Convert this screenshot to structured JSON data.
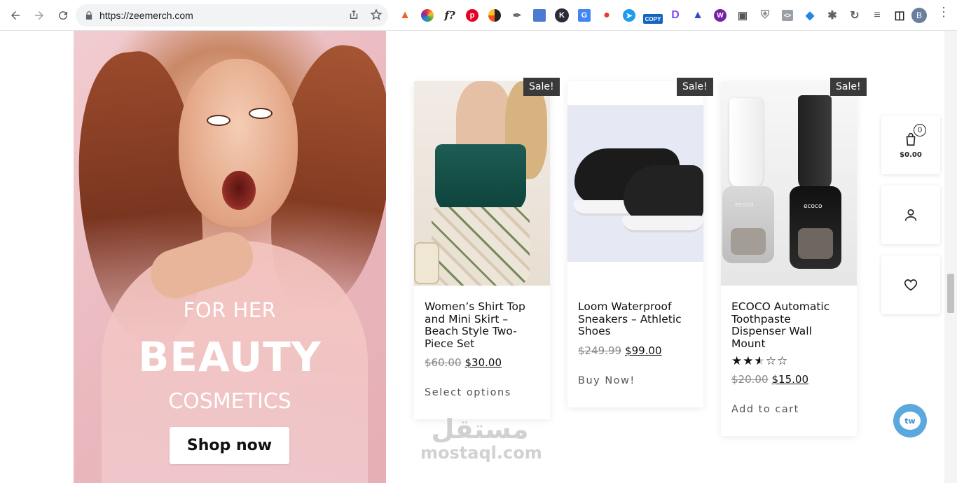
{
  "browser": {
    "url": "https://zeemerch.com",
    "profile_initial": "B",
    "extensions": [
      "fire-icon",
      "color-wheel-icon",
      "font-icon",
      "pinterest-icon",
      "color-drop-icon",
      "dropper-icon",
      "calendar-icon",
      "k-icon",
      "translate-icon",
      "paint-icon",
      "arrow-icon",
      "copy-icon",
      "d-icon",
      "triangle-icon",
      "w-icon",
      "camera-icon",
      "shield-icon",
      "code-icon",
      "diamond-icon",
      "puzzle-icon",
      "refresh-icon",
      "queue-icon",
      "sidebar-icon"
    ],
    "copy_label": "COPY",
    "font_ext_label": "f?",
    "k_ext_label": "K",
    "d_ext_label": "D",
    "w_ext_label": "W"
  },
  "hero": {
    "subtitle": "FOR HER",
    "title": "BEAUTY",
    "subtitle2": "COSMETICS",
    "button": "Shop now"
  },
  "products": [
    {
      "badge": "Sale!",
      "title": "Women’s Shirt Top and Mini Skirt – Beach Style Two-Piece Set",
      "old_price": "$60.00",
      "new_price": "$30.00",
      "action": "Select options"
    },
    {
      "badge": "Sale!",
      "title": "Loom Waterproof Sneakers – Athletic Shoes",
      "old_price": "$249.99",
      "new_price": "$99.00",
      "action": "Buy Now!"
    },
    {
      "badge": "Sale!",
      "title": "ECOCO Automatic Toothpaste Dispenser Wall Mount",
      "rating": 2.5,
      "rating_max": 5,
      "old_price": "$20.00",
      "new_price": "$15.00",
      "action": "Add to cart",
      "brand_label": "ecoco"
    }
  ],
  "widgets": {
    "cart_count": "0",
    "cart_total": "$0.00"
  },
  "chat": {
    "label": "tw"
  },
  "watermark": {
    "arabic": "مستقل",
    "latin": "mostaql.com"
  },
  "colors": {
    "badge": "#3a3a3a",
    "chat": "#5aa8de"
  }
}
